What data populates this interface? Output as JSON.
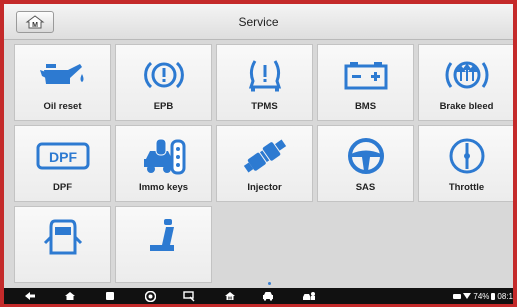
{
  "header": {
    "title": "Service"
  },
  "colors": {
    "icon_blue": "#2d7ad1",
    "frame_red": "#c42a2a",
    "tile_bg": "#f3f3f3"
  },
  "tiles": [
    {
      "label": "Oil reset",
      "icon": "oil-can-icon"
    },
    {
      "label": "EPB",
      "icon": "parking-brake-icon"
    },
    {
      "label": "TPMS",
      "icon": "tire-pressure-icon"
    },
    {
      "label": "BMS",
      "icon": "battery-icon"
    },
    {
      "label": "Brake bleed",
      "icon": "brake-bleed-icon"
    },
    {
      "label": "DPF",
      "icon": "dpf-icon"
    },
    {
      "label": "Immo keys",
      "icon": "car-keys-icon"
    },
    {
      "label": "Injector",
      "icon": "injector-icon"
    },
    {
      "label": "SAS",
      "icon": "steering-wheel-icon"
    },
    {
      "label": "Throttle",
      "icon": "throttle-icon"
    },
    {
      "label": "",
      "icon": "car-doors-icon"
    },
    {
      "label": "",
      "icon": "seat-icon"
    }
  ],
  "status_bar": {
    "battery": "74%",
    "time": "08:1"
  }
}
